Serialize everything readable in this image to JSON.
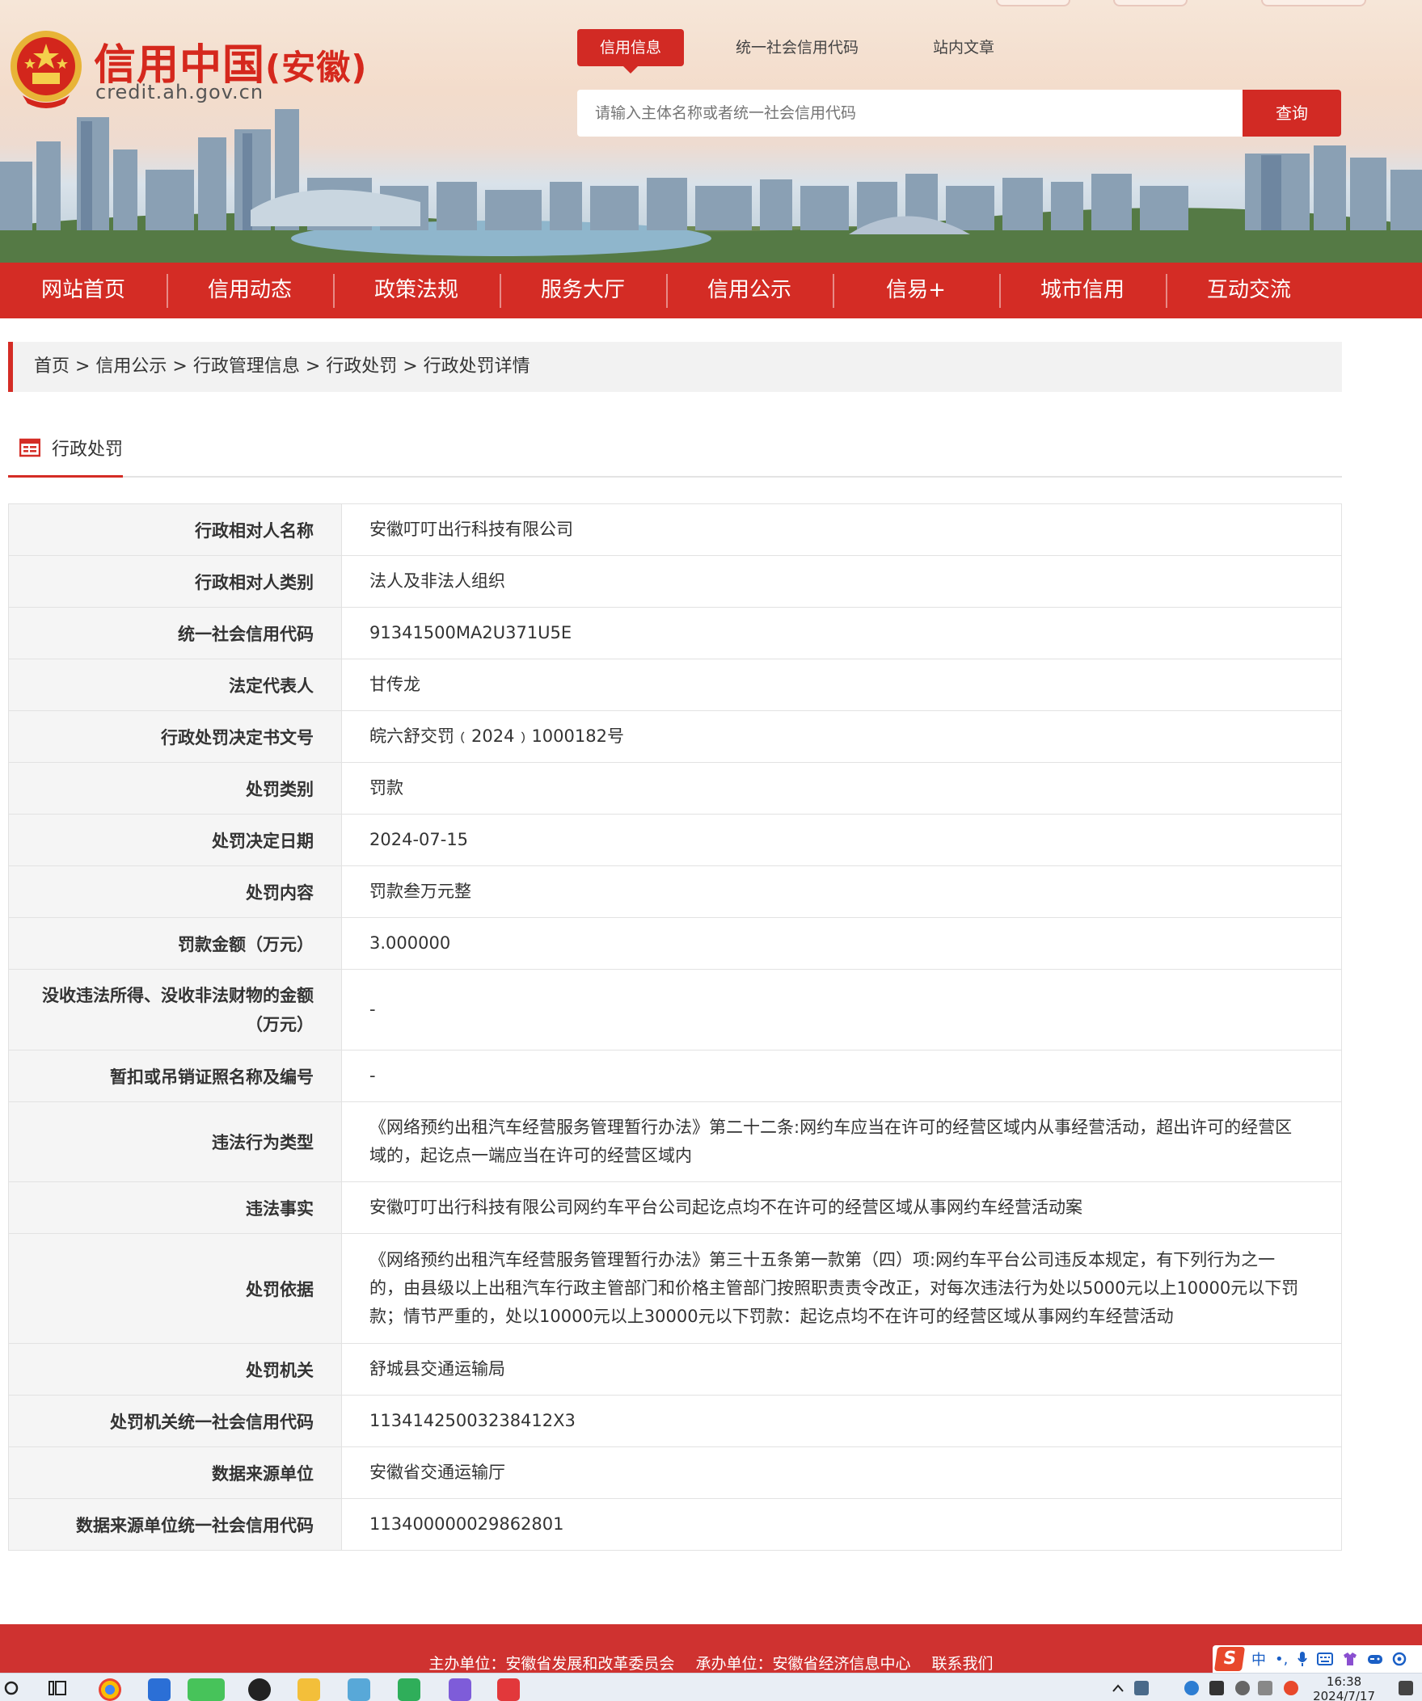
{
  "header": {
    "site_title": "信用中国",
    "site_region": "(安徽)",
    "site_url": "credit.ah.gov.cn",
    "search_tabs": [
      "信用信息",
      "统一社会信用代码",
      "站内文章"
    ],
    "search_placeholder": "请输入主体名称或者统一社会信用代码",
    "search_button": "查询",
    "brand_color": "#d42c25"
  },
  "nav": {
    "items": [
      "网站首页",
      "信用动态",
      "政策法规",
      "服务大厅",
      "信用公示",
      "信易+",
      "城市信用",
      "互动交流"
    ]
  },
  "breadcrumb": {
    "text": "首页 > 信用公示 >  行政管理信息 >  行政处罚 > 行政处罚详情"
  },
  "section": {
    "title": "行政处罚",
    "icon": "document-list-icon"
  },
  "detail": {
    "rows": [
      {
        "label": "行政相对人名称",
        "value": "安徽叮叮出行科技有限公司"
      },
      {
        "label": "行政相对人类别",
        "value": "法人及非法人组织"
      },
      {
        "label": "统一社会信用代码",
        "value": "91341500MA2U371U5E"
      },
      {
        "label": "法定代表人",
        "value": "甘传龙"
      },
      {
        "label": "行政处罚决定书文号",
        "value": "皖六舒交罚﹙2024﹚1000182号"
      },
      {
        "label": "处罚类别",
        "value": "罚款"
      },
      {
        "label": "处罚决定日期",
        "value": "2024-07-15"
      },
      {
        "label": "处罚内容",
        "value": "罚款叁万元整"
      },
      {
        "label": "罚款金额（万元）",
        "value": "3.000000"
      },
      {
        "label": "没收违法所得、没收非法财物的金额（万元）",
        "value": "-"
      },
      {
        "label": "暂扣或吊销证照名称及编号",
        "value": "-"
      },
      {
        "label": "违法行为类型",
        "value": "《网络预约出租汽车经营服务管理暂行办法》第二十二条:网约车应当在许可的经营区域内从事经营活动，超出许可的经营区域的，起讫点一端应当在许可的经营区域内"
      },
      {
        "label": "违法事实",
        "value": "安徽叮叮出行科技有限公司网约车平台公司起讫点均不在许可的经营区域从事网约车经营活动案"
      },
      {
        "label": "处罚依据",
        "value": "《网络预约出租汽车经营服务管理暂行办法》第三十五条第一款第（四）项:网约车平台公司违反本规定，有下列行为之一的，由县级以上出租汽车行政主管部门和价格主管部门按照职责责令改正，对每次违法行为处以5000元以上10000元以下罚款；情节严重的，处以10000元以上30000元以下罚款：起讫点均不在许可的经营区域从事网约车经营活动"
      },
      {
        "label": "处罚机关",
        "value": "舒城县交通运输局"
      },
      {
        "label": "处罚机关统一社会信用代码",
        "value": "11341425003238412X3"
      },
      {
        "label": "数据来源单位",
        "value": "安徽省交通运输厅"
      },
      {
        "label": "数据来源单位统一社会信用代码",
        "value": "113400000029862801"
      }
    ]
  },
  "footer": {
    "host": "主办单位：安徽省发展和改革委员会",
    "organizer": "承办单位：安徽省经济信息中心",
    "contact": "联系我们"
  },
  "ime": {
    "label": "中",
    "symbols": [
      "•,",
      "mic-icon",
      "keyboard-icon",
      "skin-icon",
      "game-icon",
      "settings-icon"
    ]
  },
  "taskbar": {
    "time": "16:38",
    "date": "2024/7/17"
  }
}
